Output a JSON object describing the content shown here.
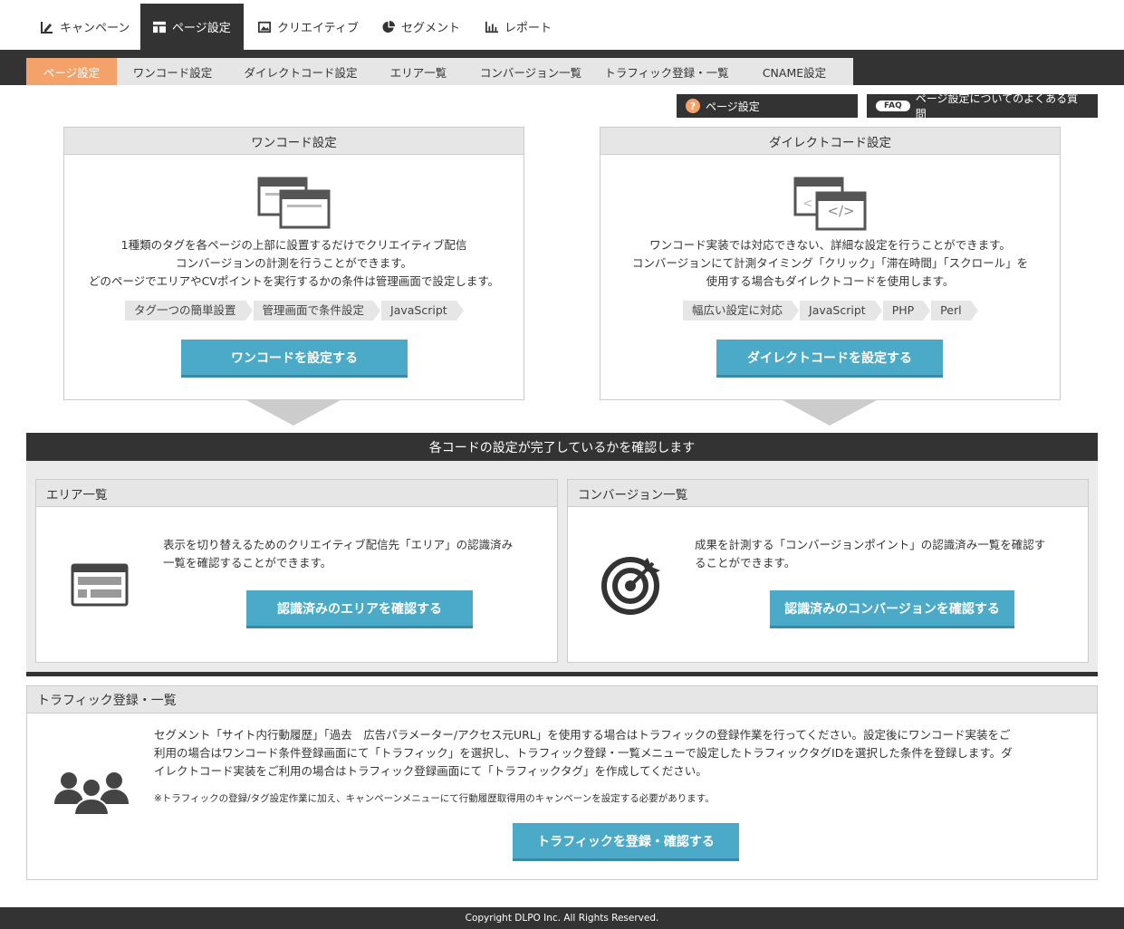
{
  "topnav": [
    {
      "label": "キャンペーン",
      "icon": "edit-chart-icon"
    },
    {
      "label": "ページ設定",
      "icon": "layout-icon",
      "active": true
    },
    {
      "label": "クリエイティブ",
      "icon": "image-icon"
    },
    {
      "label": "セグメント",
      "icon": "pie-chart-icon"
    },
    {
      "label": "レポート",
      "icon": "bar-chart-icon"
    }
  ],
  "subtabs": [
    {
      "label": "ページ設定",
      "active": true
    },
    {
      "label": "ワンコード設定"
    },
    {
      "label": "ダイレクトコード設定"
    },
    {
      "label": "エリア一覧"
    },
    {
      "label": "コンバージョン一覧"
    },
    {
      "label": "トラフィック登録・一覧"
    },
    {
      "label": "CNAME設定"
    }
  ],
  "help": {
    "page_label": "ページ設定",
    "page_icon": "?",
    "faq_icon": "FAQ",
    "faq_label": "ページ設定についてのよくある質問"
  },
  "onecode": {
    "title": "ワンコード設定",
    "desc": [
      "1種類のタグを各ページの上部に設置するだけでクリエイティブ配信",
      "コンバージョンの計測を行うことができます。",
      "どのページでエリアやCVポイントを実行するかの条件は管理画面で設定します。"
    ],
    "tags": [
      "タグ一つの簡単設置",
      "管理画面で条件設定",
      "JavaScript"
    ],
    "button": "ワンコードを設定する"
  },
  "directcode": {
    "title": "ダイレクトコード設定",
    "desc": [
      "ワンコード実装では対応できない、詳細な設定を行うことができます。",
      "コンバージョンにて計測タイミング「クリック」「滞在時間」「スクロール」を",
      "使用する場合もダイレクトコードを使用します。"
    ],
    "tags": [
      "幅広い設定に対応",
      "JavaScript",
      "PHP",
      "Perl"
    ],
    "button": "ダイレクトコードを設定する",
    "icon_text": "</>"
  },
  "confirm_bar": "各コードの設定が完了しているかを確認します",
  "area": {
    "title": "エリア一覧",
    "desc": [
      "表示を切り替えるためのクリエイティブ配信先「エリア」の認識済み",
      "一覧を確認することができます。"
    ],
    "button": "認識済みのエリアを確認する"
  },
  "conversion": {
    "title": "コンバージョン一覧",
    "desc": [
      "成果を計測する「コンバージョンポイント」の認識済み一覧を確認す",
      "ることができます。"
    ],
    "button": "認識済みのコンバージョンを確認する"
  },
  "traffic": {
    "title": "トラフィック登録・一覧",
    "desc": [
      "セグメント「サイト内行動履歴」「過去　広告パラメーター/アクセス元URL」を使用する場合はトラフィックの登録作業を行ってください。設定後にワンコード実装をご",
      "利用の場合はワンコード条件登録画面にて「トラフィック」を選択し、トラフィック登録・一覧メニューで設定したトラフィックタグIDを選択した条件を登録します。ダ",
      "イレクトコード実装をご利用の場合はトラフィック登録画面にて「トラフィックタグ」を作成してください。"
    ],
    "note": "※トラフィックの登録/タグ設定作業に加え、キャンペーンメニューにて行動履歴取得用のキャンペーンを設定する必要があります。",
    "button": "トラフィックを登録・確認する"
  },
  "footer": "Copyright DLPO Inc. All Rights Reserved."
}
